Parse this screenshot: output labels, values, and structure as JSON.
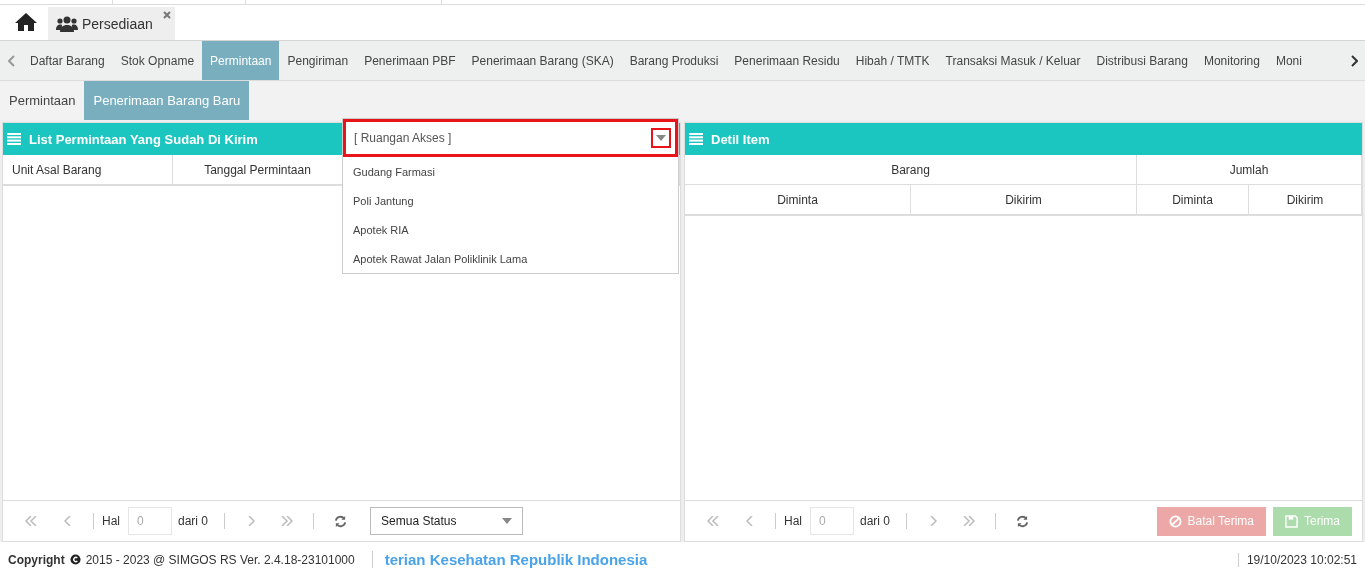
{
  "app_tabs": [
    {
      "label": "Persediaan",
      "selected": true
    }
  ],
  "nav": {
    "items": [
      {
        "label": "Daftar Barang",
        "selected": false
      },
      {
        "label": "Stok Opname",
        "selected": false
      },
      {
        "label": "Permintaan",
        "selected": true
      },
      {
        "label": "Pengiriman",
        "selected": false
      },
      {
        "label": "Penerimaan PBF",
        "selected": false
      },
      {
        "label": "Penerimaan Barang (SKA)",
        "selected": false
      },
      {
        "label": "Barang Produksi",
        "selected": false
      },
      {
        "label": "Penerimaan Residu",
        "selected": false
      },
      {
        "label": "Hibah / TMTK",
        "selected": false
      },
      {
        "label": "Transaksi Masuk / Keluar",
        "selected": false
      },
      {
        "label": "Distribusi Barang",
        "selected": false
      },
      {
        "label": "Monitoring",
        "selected": false
      },
      {
        "label": "Moni",
        "selected": false
      }
    ]
  },
  "subtabs": [
    {
      "label": "Permintaan",
      "selected": false
    },
    {
      "label": "Penerimaan Barang Baru",
      "selected": true
    }
  ],
  "left_panel": {
    "title": "List Permintaan Yang Sudah Di Kirim",
    "columns": [
      "Unit Asal Barang",
      "Tanggal Permintaan"
    ],
    "pager": {
      "page_label": "Hal",
      "page_value": "0",
      "of_label": "dari 0"
    },
    "status_select": "Semua Status"
  },
  "dropdown": {
    "placeholder": "[ Ruangan Akses ]",
    "highlighted": true,
    "expanded": true,
    "options": [
      "Gudang Farmasi",
      "Poli Jantung",
      "Apotek RIA",
      "Apotek Rawat Jalan Poliklinik Lama"
    ]
  },
  "right_panel": {
    "title": "Detil Item",
    "group_columns": [
      "Barang",
      "Jumlah"
    ],
    "columns": [
      "Diminta",
      "Dikirim",
      "Diminta",
      "Dikirim"
    ],
    "pager": {
      "page_label": "Hal",
      "page_value": "0",
      "of_label": "dari 0"
    },
    "buttons": [
      {
        "label": "Batal Terima",
        "kind": "cancel",
        "disabled": true
      },
      {
        "label": "Terima",
        "kind": "save",
        "disabled": true
      }
    ]
  },
  "footer": {
    "copyright_label": "Copyright",
    "copyright_text": "2015 - 2023 @ SIMGOS RS Ver. 2.4.18-23101000",
    "marquee": "terian Kesehatan Republik Indonesia",
    "datetime": "19/10/2023 10:02:51"
  }
}
